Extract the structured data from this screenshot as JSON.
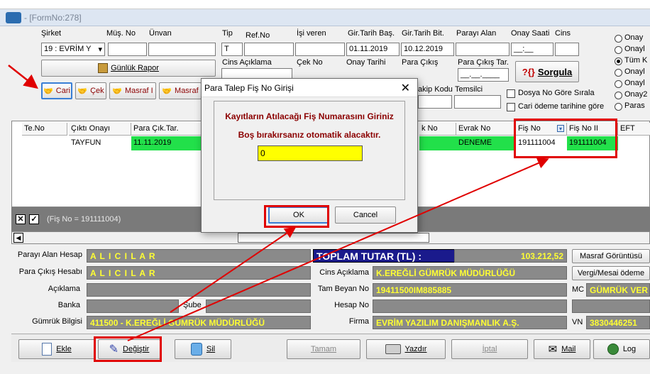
{
  "window": {
    "title": "- [FormNo:278]"
  },
  "top_labels": {
    "sirket": "Şirket",
    "mus_no": "Müş. No",
    "unvan": "Ünvan",
    "tip": "Tip",
    "ref_no": "Ref.No",
    "isi_veren": "İşi veren",
    "gir_bas": "Gir.Tarih Baş.",
    "gir_bit": "Gir.Tarih Bit.",
    "parayi_alan": "Parayı Alan",
    "onay_saati": "Onay Saati",
    "cins": "Cins",
    "cins_aciklama": "Cins Açıklama",
    "cek_no": "Çek No",
    "onay_tarihi": "Onay Tarihi",
    "para_cikis": "Para Çıkış",
    "para_cikis_tar": "Para Çıkış Tar.",
    "takip_kodu": "akip Kodu",
    "temsilci": "Temsilci"
  },
  "top_values": {
    "sirket": "19 : EVRİM Y",
    "tip": "T",
    "gir_bas": "01.11.2019",
    "gir_bit": "10.12.2019",
    "onay_saati": "__:__",
    "para_cikis_tar": "__.__.____"
  },
  "buttons": {
    "gunluk_rapor": "Günlük Rapor",
    "cari": "Cari",
    "cek": "Çek",
    "masraf1": "Masraf I",
    "masraf2": "Masraf",
    "sorgula": "Sorgula",
    "sorgula_prefix": "?{}"
  },
  "checkboxes": {
    "dosya": "Dosya No Göre Sırala",
    "cari_odeme": "Cari ödeme tarihine göre"
  },
  "radios": [
    "Onay",
    "Onayl",
    "Tüm K",
    "Onayl",
    "Onayl",
    "Onay2",
    "Paras"
  ],
  "grid": {
    "headers": [
      "Te.No",
      "Çıktı Onayı",
      "Para Çık.Tar.",
      "k No",
      "Evrak No",
      "Fiş No",
      "Fiş No II",
      "EFT"
    ],
    "row": [
      "",
      "TAYFUN",
      "11.11.2019",
      "",
      "DENEME",
      "191111004",
      "191111004",
      ""
    ]
  },
  "filter": {
    "text": "(Fiş No = 191111004)"
  },
  "bottom_panel": {
    "parayi_alan_lbl": "Parayı Alan Hesap",
    "parayi_alan_val": "A L I C I L A R",
    "para_cikis_lbl": "Para Çıkış Hesabı",
    "para_cikis_val": "A L I C I L A R",
    "aciklama_lbl": "Açıklama",
    "banka_lbl": "Banka",
    "sube_lbl": "Şube",
    "gumruk_lbl": "Gümrük Bilgisi",
    "gumruk_val": "411500 - K.EREĞLİ GÜMRÜK MÜDÜRLÜĞÜ",
    "toplam_lbl": "TOPLAM TUTAR (TL) :",
    "toplam_val": "103.212,52",
    "cins_lbl": "Cins Açıklama",
    "cins_val": "K.EREĞLİ GÜMRÜK MÜDÜRLÜĞÜ",
    "beyan_lbl": "Tam Beyan No",
    "beyan_val": "19411500IM885885",
    "hesap_lbl": "Hesap No",
    "firma_lbl": "Firma",
    "firma_val": "EVRİM YAZILIM DANIŞMANLIK A.Ş.",
    "masraf_btn": "Masraf Görüntüsü",
    "vergi_btn": "Vergi/Mesai ödeme",
    "mc_lbl": "MC",
    "mc_val": "GÜMRÜK VER",
    "vn_lbl": "VN",
    "vn_val": "3830446251"
  },
  "bottom_buttons": {
    "ekle": "Ekle",
    "degistir": "Değiştir",
    "sil": "Sil",
    "tamam": "Tamam",
    "yazdir": "Yazdır",
    "iptal": "İptal",
    "mail": "Mail",
    "log": "Log"
  },
  "dialog": {
    "title": "Para Talep Fiş No Girişi",
    "line1": "Kayıtların Atılacağı Fiş Numarasını Giriniz",
    "line2": "Boş bırakırsanız otomatik alacaktır.",
    "input_value": "0",
    "ok": "OK",
    "cancel": "Cancel"
  },
  "colors": {
    "highlight_green": "#22e04a",
    "field_yellow": "#ffff33",
    "annotation_red": "#e00000",
    "dialog_text": "#8b0000"
  }
}
